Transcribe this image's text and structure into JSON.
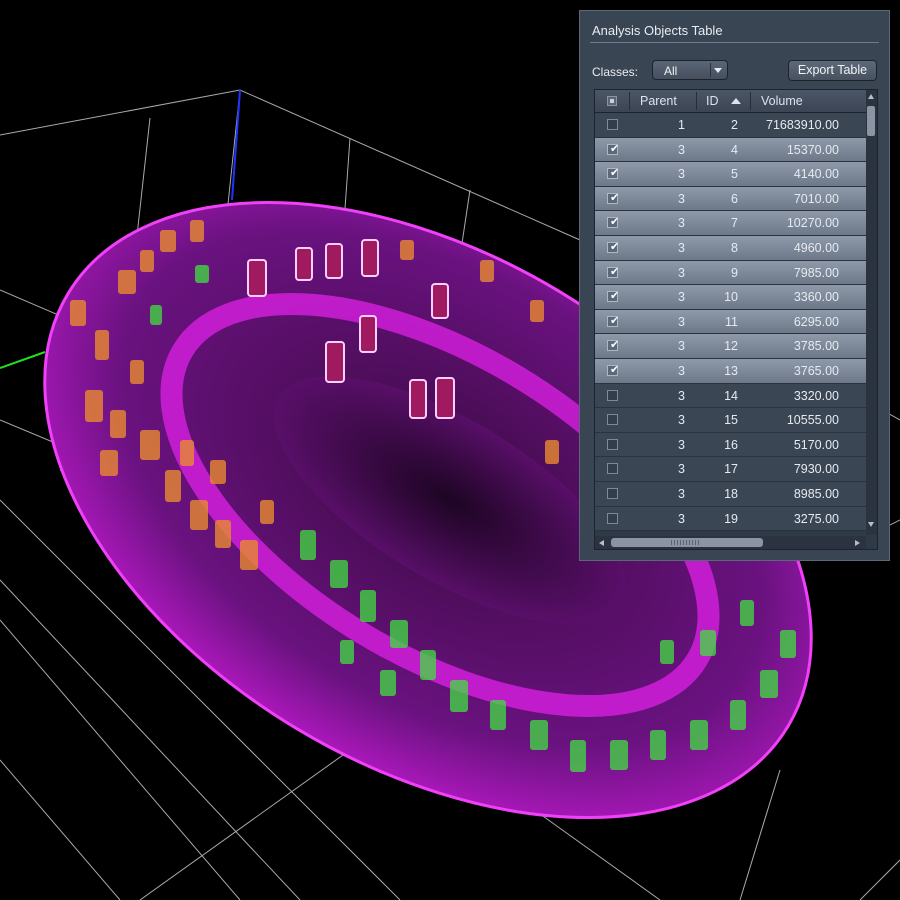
{
  "viewport": {
    "name": "3D volume rendering",
    "colors": {
      "membrane": "#e020e8",
      "class_orange": "#e88a30",
      "class_green": "#40e040",
      "axis_blue": "#2233ff",
      "axis_green": "#22dd22",
      "grid": "#c8c8c8"
    }
  },
  "panel": {
    "title": "Analysis Objects Table",
    "classes_label": "Classes:",
    "classes_value": "All",
    "export_label": "Export Table",
    "columns": [
      "Parent",
      "ID",
      "Volume"
    ],
    "sort_column": "ID",
    "sort_direction": "ascending",
    "rows": [
      {
        "selected": false,
        "parent": "1",
        "id": "2",
        "volume": "71683910.00"
      },
      {
        "selected": true,
        "parent": "3",
        "id": "4",
        "volume": "15370.00"
      },
      {
        "selected": true,
        "parent": "3",
        "id": "5",
        "volume": "4140.00"
      },
      {
        "selected": true,
        "parent": "3",
        "id": "6",
        "volume": "7010.00"
      },
      {
        "selected": true,
        "parent": "3",
        "id": "7",
        "volume": "10270.00"
      },
      {
        "selected": true,
        "parent": "3",
        "id": "8",
        "volume": "4960.00"
      },
      {
        "selected": true,
        "parent": "3",
        "id": "9",
        "volume": "7985.00"
      },
      {
        "selected": true,
        "parent": "3",
        "id": "10",
        "volume": "3360.00"
      },
      {
        "selected": true,
        "parent": "3",
        "id": "11",
        "volume": "6295.00"
      },
      {
        "selected": true,
        "parent": "3",
        "id": "12",
        "volume": "3785.00"
      },
      {
        "selected": true,
        "parent": "3",
        "id": "13",
        "volume": "3765.00"
      },
      {
        "selected": false,
        "parent": "3",
        "id": "14",
        "volume": "3320.00"
      },
      {
        "selected": false,
        "parent": "3",
        "id": "15",
        "volume": "10555.00"
      },
      {
        "selected": false,
        "parent": "3",
        "id": "16",
        "volume": "5170.00"
      },
      {
        "selected": false,
        "parent": "3",
        "id": "17",
        "volume": "7930.00"
      },
      {
        "selected": false,
        "parent": "3",
        "id": "18",
        "volume": "8985.00"
      },
      {
        "selected": false,
        "parent": "3",
        "id": "19",
        "volume": "3275.00"
      }
    ],
    "icons": [
      "select-all-checkbox",
      "sort-ascending-icon",
      "dropdown-chevron-icon",
      "checkmark-icon",
      "scroll-up-icon",
      "scroll-down-icon",
      "scroll-left-icon",
      "scroll-right-icon"
    ]
  }
}
